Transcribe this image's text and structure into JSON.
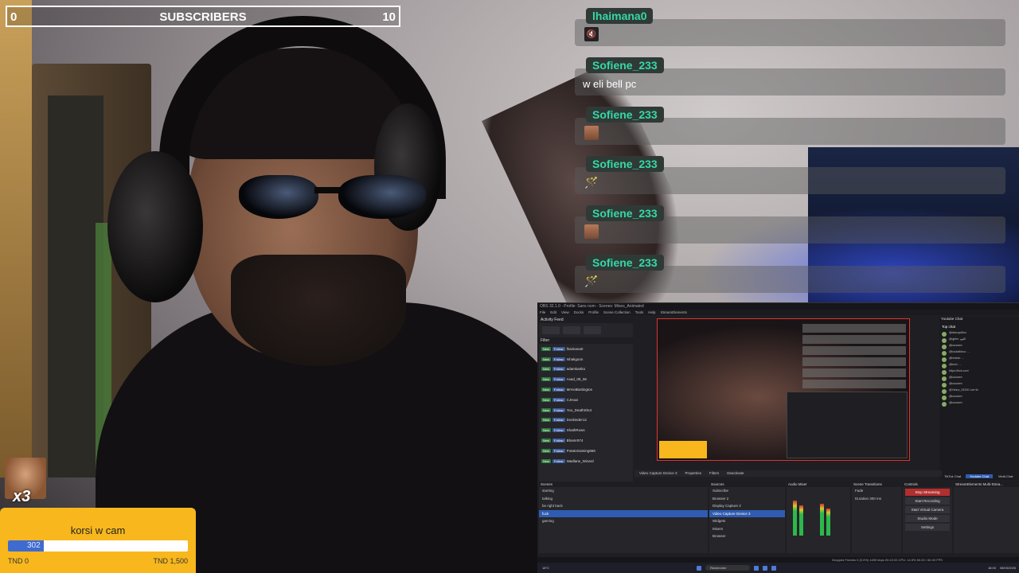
{
  "subscribers": {
    "left": "0",
    "title": "SUBSCRIBERS",
    "right": "10"
  },
  "chat": [
    {
      "user": "lhaimana0",
      "text": "",
      "emote": "🔇",
      "emote_kind": "mute"
    },
    {
      "user": "Sofiene_233",
      "text": "w eli bell pc",
      "emote": "",
      "emote_kind": ""
    },
    {
      "user": "Sofiene_233",
      "text": "",
      "emote": "",
      "emote_kind": "face"
    },
    {
      "user": "Sofiene_233",
      "text": "",
      "emote": "🪄",
      "emote_kind": "wand"
    },
    {
      "user": "Sofiene_233",
      "text": "",
      "emote": "",
      "emote_kind": "face"
    },
    {
      "user": "Sofiene_233",
      "text": "",
      "emote": "🪄",
      "emote_kind": "wand"
    }
  ],
  "goal": {
    "title": "korsi w cam",
    "current": "302",
    "min_label": "TND 0",
    "max_label": "TND 1,500",
    "progress_fraction": 0.2013
  },
  "combo": {
    "label": "x3"
  },
  "obs": {
    "title": "OBS 32.1.0 - Profile: Sans nom - Scenes: Mixes_Animated",
    "menu": [
      "File",
      "Edit",
      "View",
      "Docks",
      "Profile",
      "Scene Collection",
      "Tools",
      "Help",
      "StreamElements"
    ],
    "activity_title": "Activity Feed",
    "filter_label": "Filter",
    "activity_rows": [
      "lhaimana0",
      "Ishakgoon",
      "adamkartko",
      "Asad_08_06",
      "MrHotButtington",
      "CJHaxi",
      "Yoo_DeathShot",
      "Doskinder12",
      "ShathRows",
      "Bhamr974",
      "PotatoGaming666",
      "Wadlane_Wizard"
    ],
    "tag_new": "New",
    "tag_follow": "Follow",
    "youtube_title": "Youtube Chat",
    "top_chat": "Top chat",
    "yt_lines": [
      "@diaruqu8mo",
      "@qjdhs: اللهم",
      "@loussem",
      "@loudatkbou: ...",
      "@hmdsk: ...",
      "@kmlc: ...",
      "https://kick.com/",
      "@loussem",
      "@loussem",
      "@Yahoo_33330 Live fiz",
      "@loussem",
      "@loussem"
    ],
    "yt_tabs": [
      "TikTok Chat",
      "Youtube Chat",
      "Multi-Chat"
    ],
    "source_bar": [
      "Video Capture Device 3",
      "Properties",
      "Filters",
      "Deactivate"
    ],
    "scenes_title": "Scenes",
    "scenes": [
      "starting",
      "talking",
      "be right back",
      "fuck",
      "gaming"
    ],
    "selected_scene": "fuck",
    "sources_title": "Sources",
    "sources": [
      "Subscribe",
      "Browser 2",
      "Display Capture 2",
      "Video Capture Device 3",
      "Widgets",
      "Mixers",
      "Browser"
    ],
    "mixer_title": "Audio Mixer",
    "transitions_title": "Scene Transitions",
    "transition": "Fade",
    "duration_label": "Duration",
    "duration": "300 ms",
    "controls_title": "Controls",
    "controls": [
      "Stop Streaming",
      "Start Recording",
      "Start Virtual Camera",
      "Studio Mode",
      "Settings"
    ],
    "se_title": "StreamElements Multi-Strea...",
    "status": "Dropped Frames 0 (0.0%)   4490 kbps   00:22:03   CPU: 14.5%   60.00 / 60.00 FPS"
  },
  "taskbar": {
    "weather": "18°C",
    "search": "Rechercher",
    "time": "18:00",
    "date": "08/03/2026"
  },
  "colors": {
    "chat_name": "#37d8a5",
    "goal_bg": "#f7b71d",
    "goal_fill": "#3f6bd1"
  }
}
